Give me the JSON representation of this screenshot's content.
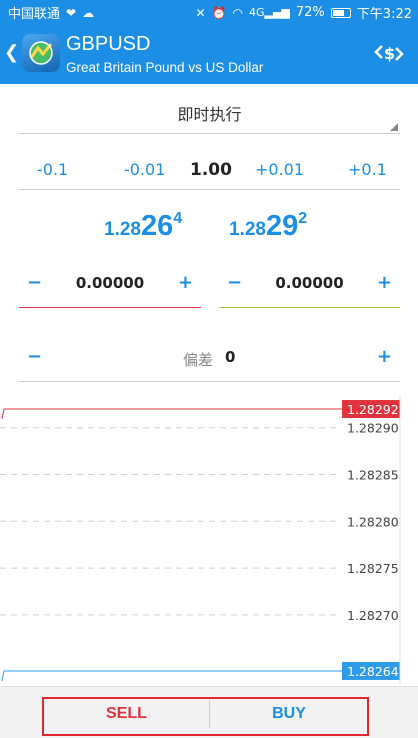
{
  "statusbar": {
    "carrier": "中国联通",
    "signal_label": "4G",
    "battery": "72%",
    "battery_level": 0.72,
    "time": "下午3:22"
  },
  "header": {
    "back_icon": "chevron-left-icon",
    "symbol": "GBPUSD",
    "description": "Great Britain Pound vs US Dollar",
    "action_icon": "trade-icon"
  },
  "order": {
    "execution_type": "即时执行",
    "volume_steps": [
      "-0.1",
      "-0.01",
      "1.00",
      "+0.01",
      "+0.1"
    ],
    "bid": {
      "prefix": "1.28",
      "big": "26",
      "sup": "4"
    },
    "ask": {
      "prefix": "1.28",
      "big": "29",
      "sup": "2"
    },
    "stop_loss": {
      "minus": "−",
      "value": "0.00000",
      "plus": "+"
    },
    "take_profit": {
      "minus": "−",
      "value": "0.00000",
      "plus": "+"
    },
    "deviation": {
      "minus": "−",
      "label": "偏差",
      "value": "0",
      "plus": "+"
    }
  },
  "chart_data": {
    "type": "line",
    "ask_line": 1.28292,
    "bid_line": 1.28264,
    "ask_label": "1.28292",
    "bid_label": "1.28264",
    "y_ticks": [
      "1.28290",
      "1.28285",
      "1.28280",
      "1.28275",
      "1.28270"
    ],
    "y_tick_values": [
      1.2829,
      1.28285,
      1.2828,
      1.28275,
      1.2827
    ],
    "ylim": [
      1.282625,
      1.282935
    ],
    "grid": true,
    "ask_color": "#e0333d",
    "bid_color": "#2e9be8"
  },
  "actions": {
    "sell_label": "SELL",
    "buy_label": "BUY"
  },
  "colors": {
    "brand": "#1c8ee6",
    "sell": "#e0333d",
    "buy": "#1c8ee6",
    "take_profit_line": "#a5c531"
  }
}
